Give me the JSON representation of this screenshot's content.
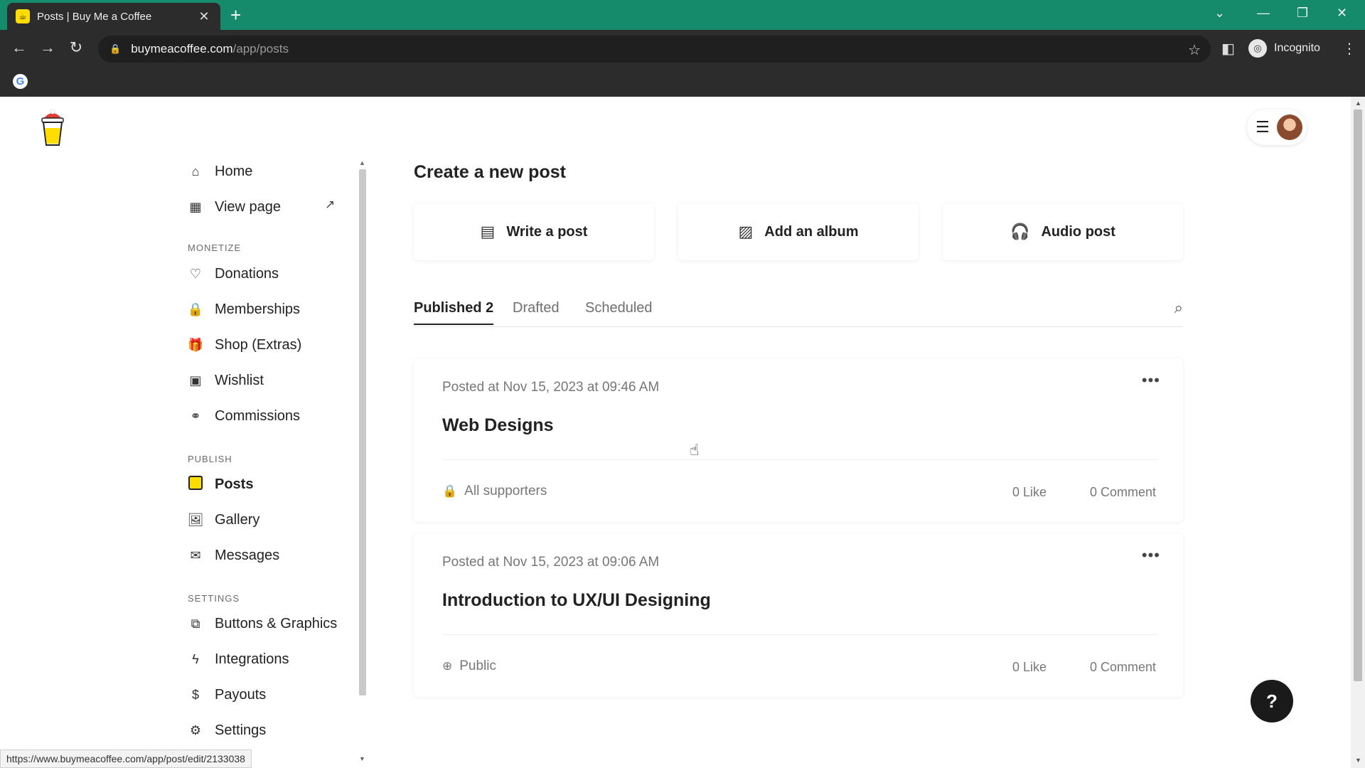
{
  "browser": {
    "tab_title": "Posts | Buy Me a Coffee",
    "url_host": "buymeacoffee.com",
    "url_path": "/app/posts",
    "profile_label": "Incognito",
    "status_url": "https://www.buymeacoffee.com/app/post/edit/2133038"
  },
  "sidebar": {
    "top": [
      {
        "label": "Home",
        "icon": "home-icon"
      },
      {
        "label": "View page",
        "icon": "layout-icon"
      }
    ],
    "monetize_label": "MONETIZE",
    "monetize": [
      {
        "label": "Donations",
        "icon": "heart-icon"
      },
      {
        "label": "Memberships",
        "icon": "lock-icon"
      },
      {
        "label": "Shop (Extras)",
        "icon": "gift-icon"
      },
      {
        "label": "Wishlist",
        "icon": "wishlist-icon"
      },
      {
        "label": "Commissions",
        "icon": "handshake-icon"
      }
    ],
    "publish_label": "PUBLISH",
    "publish": [
      {
        "label": "Posts",
        "icon": "posts-icon",
        "active": true
      },
      {
        "label": "Gallery",
        "icon": "image-icon"
      },
      {
        "label": "Messages",
        "icon": "mail-icon"
      }
    ],
    "settings_label": "SETTINGS",
    "settings": [
      {
        "label": "Buttons & Graphics",
        "icon": "code-window-icon"
      },
      {
        "label": "Integrations",
        "icon": "bolt-icon"
      },
      {
        "label": "Payouts",
        "icon": "dollar-icon"
      },
      {
        "label": "Settings",
        "icon": "gear-icon"
      }
    ]
  },
  "main": {
    "create_title": "Create a new post",
    "create_options": [
      {
        "label": "Write a post",
        "icon": "document-icon"
      },
      {
        "label": "Add an album",
        "icon": "image-icon"
      },
      {
        "label": "Audio post",
        "icon": "headphones-icon"
      }
    ],
    "tabs": [
      {
        "label": "Published 2",
        "active": true
      },
      {
        "label": "Drafted",
        "active": false
      },
      {
        "label": "Scheduled",
        "active": false
      }
    ],
    "posts": [
      {
        "meta": "Posted at Nov 15, 2023 at 09:46 AM",
        "title": "Web Designs",
        "visibility": "All supporters",
        "visibility_icon": "lock-icon",
        "likes": "0 Like",
        "comments": "0 Comment"
      },
      {
        "meta": "Posted at Nov 15, 2023 at 09:06 AM",
        "title": "Introduction to UX/UI Designing",
        "visibility": "Public",
        "visibility_icon": "globe-icon",
        "likes": "0 Like",
        "comments": "0 Comment"
      }
    ]
  },
  "help_label": "?",
  "colors": {
    "tabbar": "#168b6b",
    "chrome_dark": "#2c2c2c",
    "brand_yellow": "#ffdd00"
  }
}
